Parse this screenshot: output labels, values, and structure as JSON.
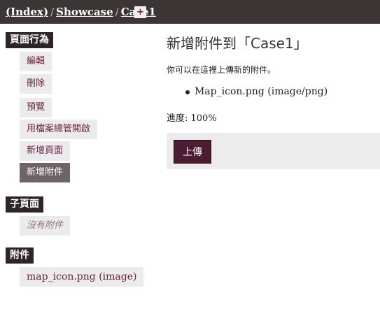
{
  "breadcrumb": {
    "items": [
      "(Index)",
      "Showcase",
      "Case1"
    ],
    "separator": "/",
    "add_button": "+"
  },
  "sidebar": {
    "page_actions": {
      "heading": "頁面行為",
      "items": [
        "編輯",
        "刪除",
        "預覽",
        "用檔案總管開啟",
        "新增頁面",
        "新增附件"
      ],
      "active_index": 5
    },
    "subpages": {
      "heading": "子頁面",
      "empty": "沒有附件"
    },
    "attachments": {
      "heading": "附件",
      "items": [
        "map_icon.png (image)"
      ]
    }
  },
  "main": {
    "title": "新增附件到「Case1」",
    "description": "你可以在這裡上傳新的附件。",
    "files": [
      "Map_icon.png (image/png)"
    ],
    "progress": "進度: 100%",
    "upload_button": "上傳"
  },
  "colors": {
    "topbar": "#3c3536",
    "accent": "#6b2342",
    "upload_button": "#4c1c32"
  }
}
